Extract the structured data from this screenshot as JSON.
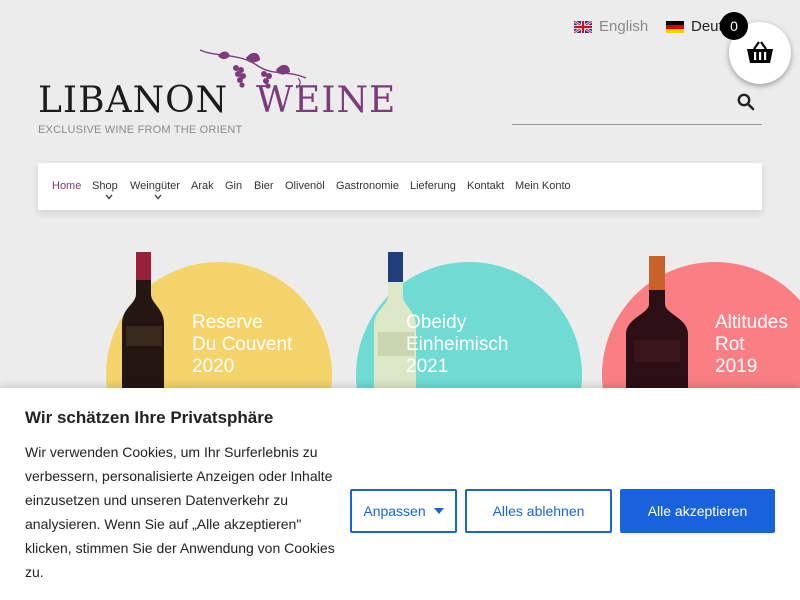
{
  "languages": [
    {
      "label": "English",
      "flag": "uk-flag-icon"
    },
    {
      "label": "Deut",
      "flag": "german-flag-icon"
    }
  ],
  "cart": {
    "count": "0",
    "icon": "basket-icon"
  },
  "logo": {
    "word1": "LIBANON",
    "word2": "WEINE",
    "tagline": "EXCLUSIVE WINE FROM THE ORIENT"
  },
  "search": {
    "icon": "search-icon"
  },
  "nav": {
    "items": [
      {
        "label": "Home"
      },
      {
        "label": "Shop"
      },
      {
        "label": "Weingüter"
      },
      {
        "label": "Arak"
      },
      {
        "label": "Gin"
      },
      {
        "label": "Bier"
      },
      {
        "label": "Olivenöl"
      },
      {
        "label": "Gastronomie"
      },
      {
        "label": "Lieferung"
      },
      {
        "label": "Kontakt"
      },
      {
        "label": "Mein Konto"
      }
    ]
  },
  "products": [
    {
      "line1": "Reserve",
      "line2": "Du Couvent",
      "line3": "2020",
      "color": "#f4d36b"
    },
    {
      "line1": "Obeidy",
      "line2": "Einheimisch",
      "line3": "2021",
      "color": "#6fdbd3"
    },
    {
      "line1": "Altitudes",
      "line2": "Rot",
      "line3": "2019",
      "color": "#f97f84"
    }
  ],
  "cookie": {
    "title": "Wir schätzen Ihre Privatsphäre",
    "text": "Wir verwenden Cookies, um Ihr Surferlebnis zu verbessern, personalisierte Anzeigen oder Inhalte einzusetzen und unseren Datenverkehr zu analysieren. Wenn Sie auf „Alle akzeptieren\" klicken, stimmen Sie der Anwendung von Cookies zu.",
    "customize": "Anpassen",
    "reject": "Alles ablehnen",
    "accept": "Alle akzeptieren"
  },
  "colors": {
    "brand": "#7d3b7c",
    "button_blue": "#1863dc"
  }
}
